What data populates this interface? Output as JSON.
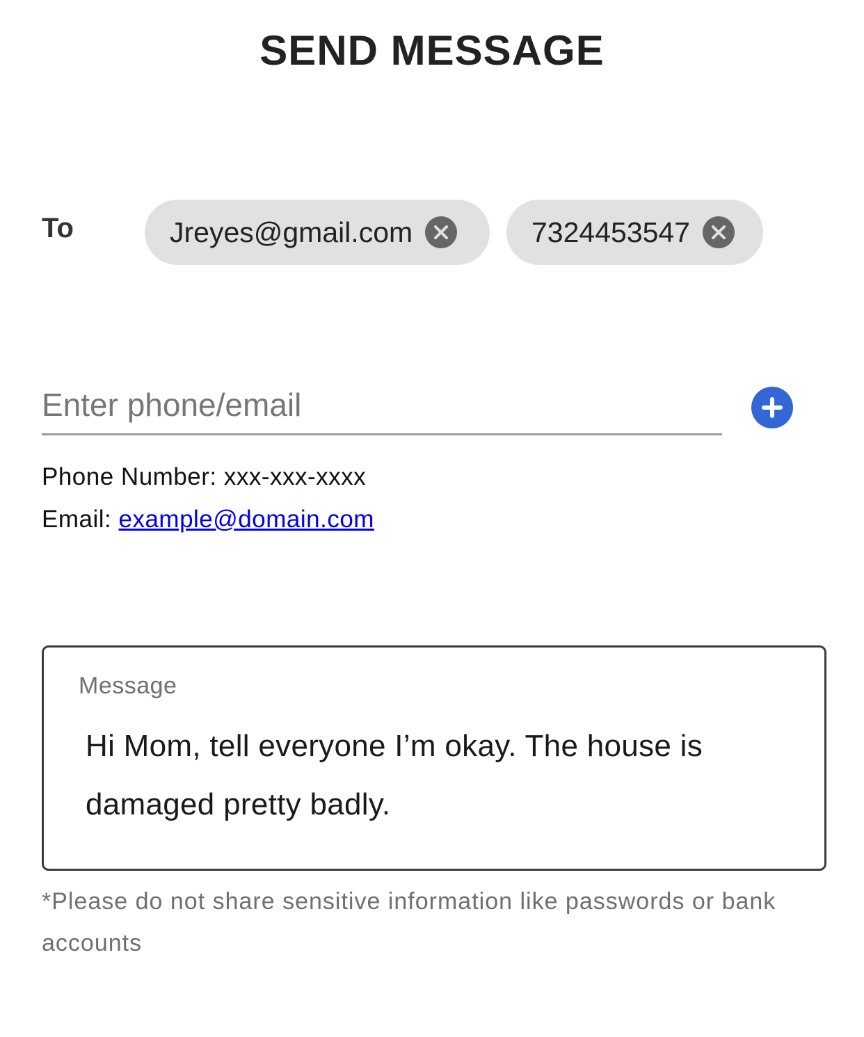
{
  "header": {
    "title": "SEND MESSAGE"
  },
  "recipients": {
    "to_label": "To",
    "chips": [
      {
        "value": "Jreyes@gmail.com",
        "remove_icon": "close-circle-icon"
      },
      {
        "value": "7324453547",
        "remove_icon": "close-circle-icon"
      }
    ]
  },
  "recipient_input": {
    "placeholder": "Enter phone/email",
    "value": "",
    "add_icon": "plus-circle-icon",
    "accent_color": "#3367d6"
  },
  "format_hints": {
    "phone_label": "Phone Number:",
    "phone_format": "xxx-xxx-xxxx",
    "email_label": "Email:",
    "email_example": "example@domain.com"
  },
  "message": {
    "label": "Message",
    "value": "Hi Mom, tell everyone I’m okay. The house is damaged pretty badly."
  },
  "disclaimer": "*Please do not share sensitive information like passwords or bank accounts"
}
